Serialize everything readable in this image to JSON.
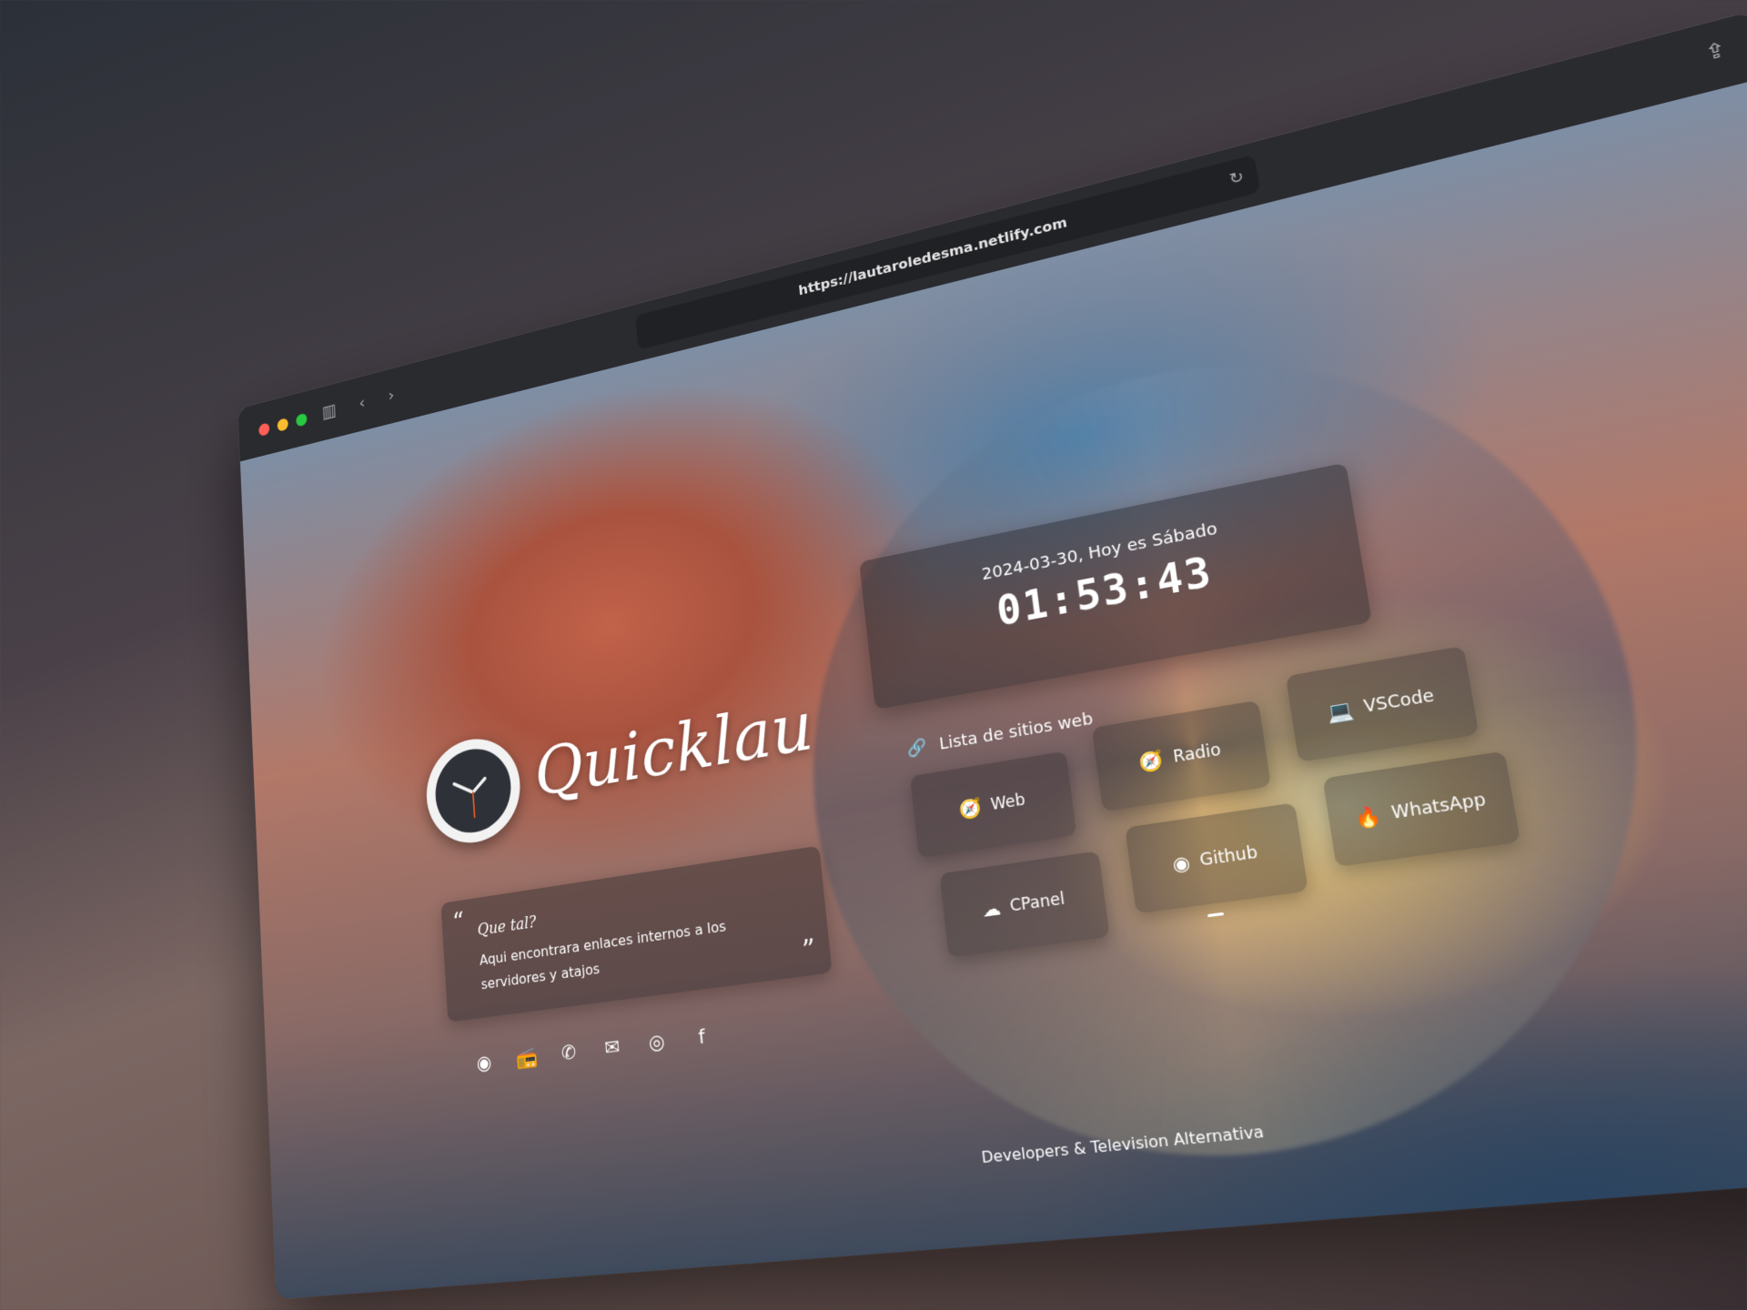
{
  "browser": {
    "url": "https://lautaroledesma.netlify.com",
    "icons": [
      "sidebar-icon",
      "back-icon",
      "forward-icon",
      "reload-icon",
      "share-icon"
    ]
  },
  "brand": {
    "title": "Quicklau"
  },
  "quote": {
    "title": "Que tal?",
    "text": "Aqui encontrara enlaces internos a los servidores y atajos",
    "open": "“",
    "close": "”"
  },
  "clock": {
    "date": "2024-03-30, Hoy es Sábado",
    "time": "01:53:43"
  },
  "sites": {
    "label": "Lista de sitios web",
    "items": [
      {
        "label": "Web",
        "icon": "compass-icon"
      },
      {
        "label": "Radio",
        "icon": "compass-icon"
      },
      {
        "label": "VSCode",
        "icon": "laptop-code-icon"
      },
      {
        "label": "CPanel",
        "icon": "cloud-icon"
      },
      {
        "label": "Github",
        "icon": "github-icon"
      },
      {
        "label": "WhatsApp",
        "icon": "flame-icon"
      }
    ]
  },
  "social": [
    "github-icon",
    "radio-icon",
    "whatsapp-icon",
    "mail-icon",
    "instagram-icon",
    "facebook-icon"
  ],
  "footer": {
    "text": "Developers & Television Alternativa"
  }
}
